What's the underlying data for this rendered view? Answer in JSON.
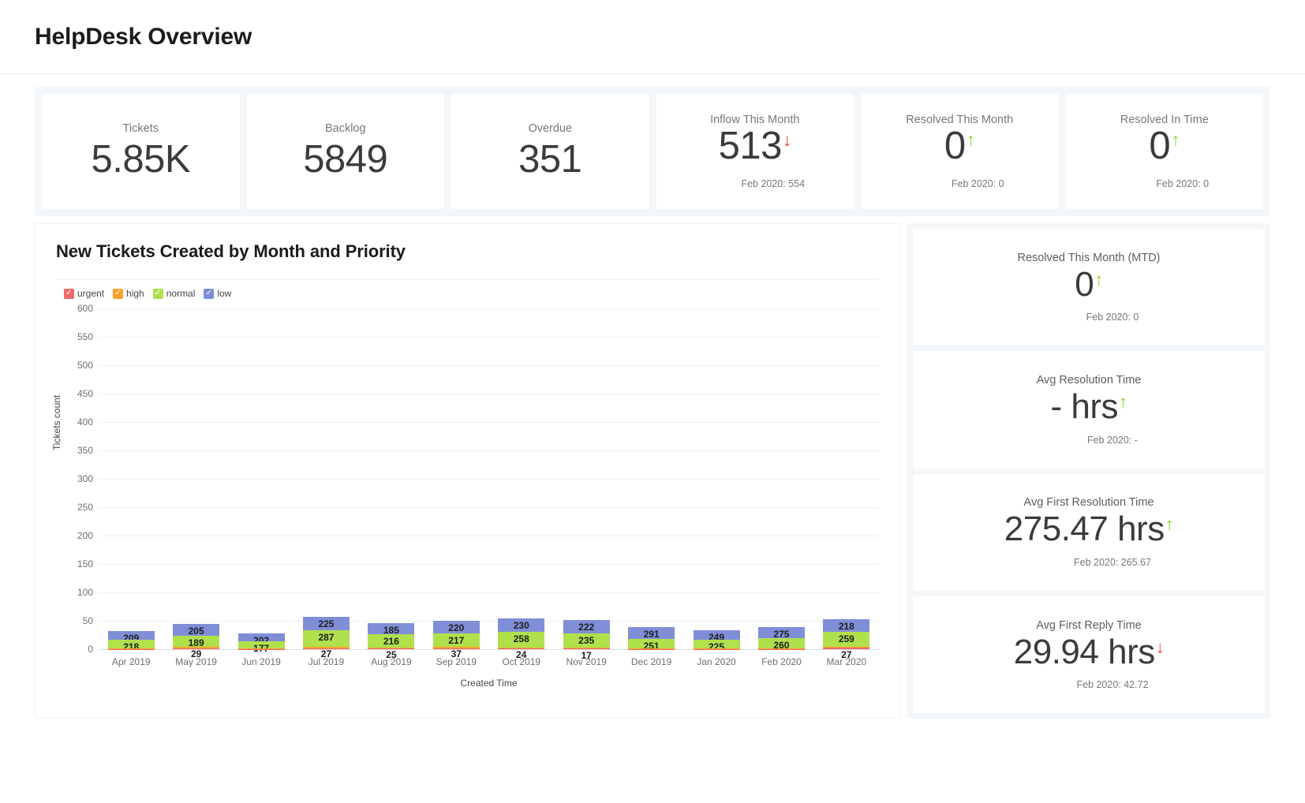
{
  "header": {
    "title": "HelpDesk Overview"
  },
  "kpis": [
    {
      "label": "Tickets",
      "value": "5.85K",
      "arrow": "",
      "sub": ""
    },
    {
      "label": "Backlog",
      "value": "5849",
      "arrow": "",
      "sub": ""
    },
    {
      "label": "Overdue",
      "value": "351",
      "arrow": "",
      "sub": ""
    },
    {
      "label": "Inflow This Month",
      "value": "513",
      "arrow": "down",
      "arrow_glyph": "↓",
      "sub": "Feb 2020: 554"
    },
    {
      "label": "Resolved This Month",
      "value": "0",
      "arrow": "up",
      "arrow_glyph": "↑",
      "sub": "Feb 2020: 0"
    },
    {
      "label": "Resolved In Time",
      "value": "0",
      "arrow": "up",
      "arrow_glyph": "↑",
      "sub": "Feb 2020: 0"
    }
  ],
  "rail": [
    {
      "label": "Resolved This Month (MTD)",
      "value": "0",
      "arrow": "up",
      "arrow_glyph": "↑",
      "sub": "Feb 2020: 0"
    },
    {
      "label": "Avg Resolution Time",
      "value": "- hrs",
      "arrow": "up",
      "arrow_glyph": "↑",
      "sub": "Feb 2020: -"
    },
    {
      "label": "Avg First Resolution Time",
      "value": "275.47 hrs",
      "arrow": "up",
      "arrow_glyph": "↑",
      "sub": "Feb 2020: 265.67"
    },
    {
      "label": "Avg First Reply Time",
      "value": "29.94 hrs",
      "arrow": "down",
      "arrow_glyph": "↓",
      "sub": "Feb 2020: 42.72"
    }
  ],
  "chart_data": {
    "type": "bar",
    "stacked": true,
    "title": "New Tickets Created by Month and Priority",
    "xlabel": "Created Time",
    "ylabel": "Tickets count",
    "ylim": [
      0,
      600
    ],
    "yticks": [
      0,
      50,
      100,
      150,
      200,
      250,
      300,
      350,
      400,
      450,
      500,
      550,
      600
    ],
    "grid": true,
    "legend_position": "top-left",
    "legend": [
      {
        "label": "urgent",
        "color": "#ed6a6a",
        "checked": true
      },
      {
        "label": "high",
        "color": "#f9a22e",
        "checked": true
      },
      {
        "label": "normal",
        "color": "#b0e04c",
        "checked": true
      },
      {
        "label": "low",
        "color": "#808ed8",
        "checked": true
      }
    ],
    "categories": [
      "Apr 2019",
      "May 2019",
      "Jun 2019",
      "Jul 2019",
      "Aug 2019",
      "Sep 2019",
      "Oct 2019",
      "Nov 2019",
      "Dec 2019",
      "Jan 2020",
      "Feb 2020",
      "Mar 2020"
    ],
    "series": [
      {
        "name": "urgent",
        "color": "#ed6a6a",
        "values": [
          9,
          10,
          8,
          9,
          8,
          9,
          8,
          17,
          8,
          8,
          9,
          27
        ]
      },
      {
        "name": "high",
        "color": "#f9a22e",
        "values": [
          15,
          29,
          10,
          27,
          25,
          37,
          24,
          16,
          8,
          7,
          17,
          9
        ]
      },
      {
        "name": "normal",
        "color": "#b0e04c",
        "values": [
          218,
          189,
          177,
          287,
          216,
          217,
          258,
          235,
          251,
          225,
          260,
          259
        ]
      },
      {
        "name": "low",
        "color": "#808ed8",
        "values": [
          209,
          205,
          202,
          225,
          185,
          220,
          230,
          222,
          291,
          249,
          275,
          218
        ]
      }
    ],
    "bar_labels": {
      "urgent": [
        "",
        "",
        "",
        "",
        "",
        "",
        "",
        "17",
        "",
        "",
        "",
        "27"
      ],
      "high": [
        "",
        "29",
        "",
        "27",
        "25",
        "37",
        "24",
        "",
        "",
        "",
        "",
        ""
      ],
      "normal": [
        "218",
        "189",
        "177",
        "287",
        "216",
        "217",
        "258",
        "235",
        "251",
        "225",
        "260",
        "259"
      ],
      "low": [
        "209",
        "205",
        "202",
        "225",
        "185",
        "220",
        "230",
        "222",
        "291",
        "249",
        "275",
        "218"
      ]
    }
  }
}
